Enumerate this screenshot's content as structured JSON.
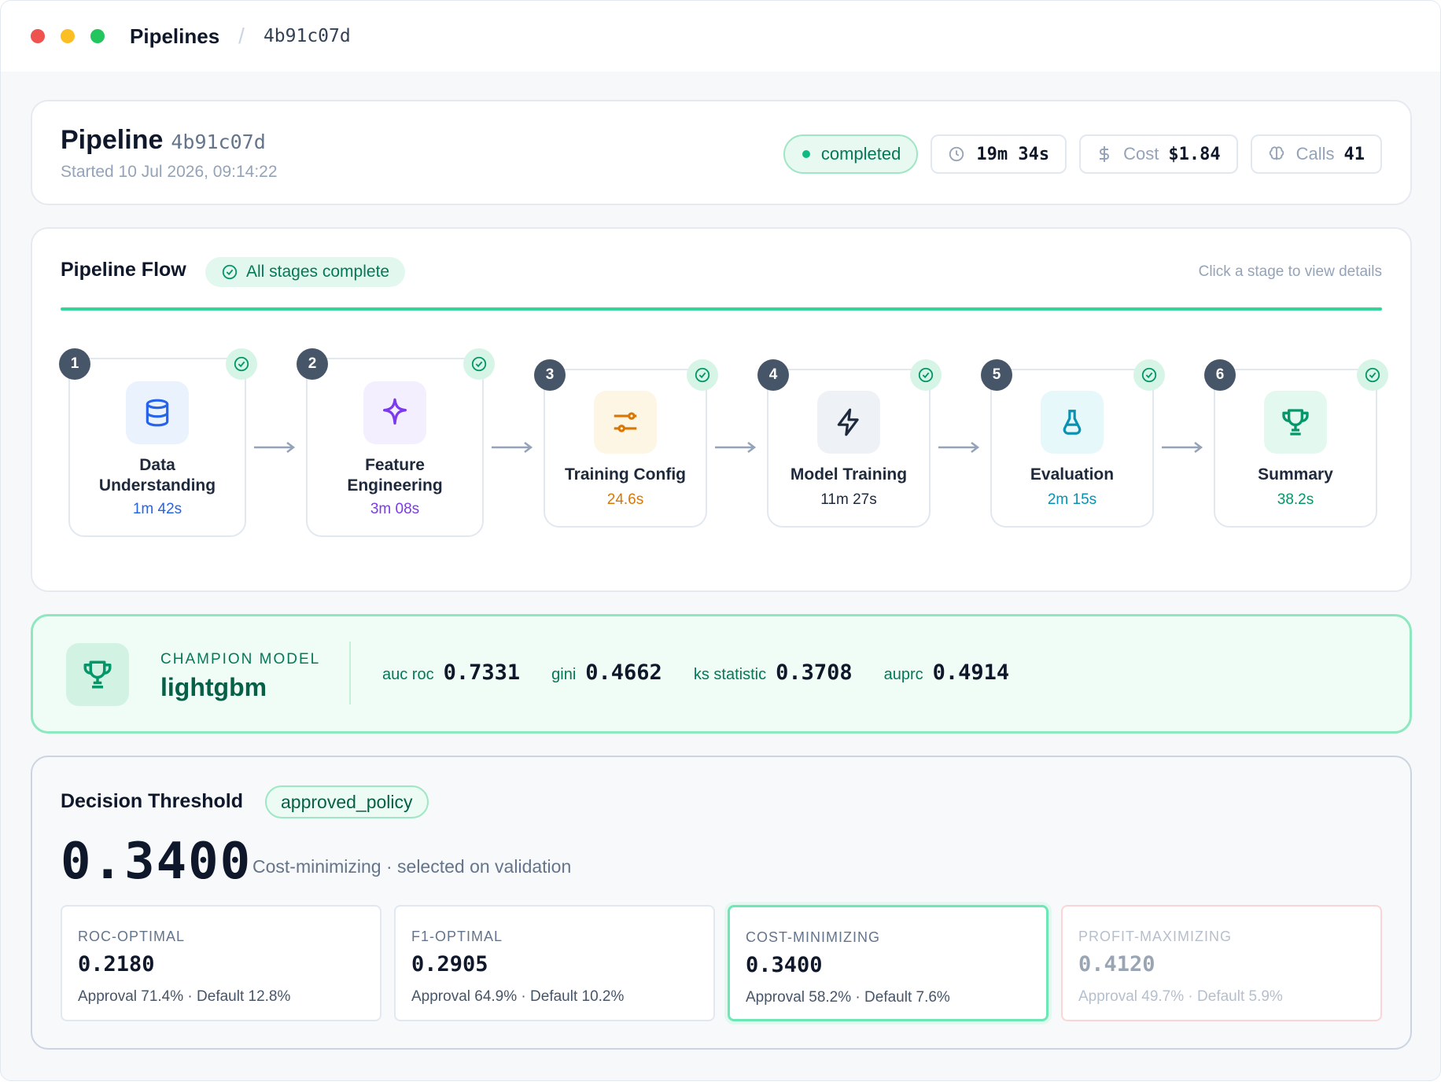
{
  "titlebar": {
    "dots": [
      "#ef5350",
      "#fbbf24",
      "#22c55e"
    ],
    "crumb_main": "Pipelines",
    "crumb_sep": "/",
    "crumb_id": "4b91c07d"
  },
  "header": {
    "title": "Pipeline",
    "id": "4b91c07d",
    "started": "Started 10 Jul 2026, 09:14:22",
    "status": "completed",
    "duration": "19m 34s",
    "cost_label": "Cost",
    "cost_value": "$1.84",
    "calls_label": "Calls",
    "calls_value": "41"
  },
  "flow": {
    "title": "Pipeline Flow",
    "badge": "All stages complete",
    "hint": "Click a stage to view details",
    "stages": [
      {
        "num": "1",
        "line1": "Data",
        "line2": "Understanding",
        "duration": "1m 42s",
        "icon": "database-icon",
        "color": "#2563eb",
        "bg": "#eaf2fe"
      },
      {
        "num": "2",
        "line1": "Feature",
        "line2": "Engineering",
        "duration": "3m 08s",
        "icon": "sparkle-icon",
        "color": "#7c3aed",
        "bg": "#f3effe"
      },
      {
        "num": "3",
        "line1": "Training Config",
        "line2": "",
        "duration": "24.6s",
        "icon": "sliders-icon",
        "color": "#d97706",
        "bg": "#fef6e4"
      },
      {
        "num": "4",
        "line1": "Model Training",
        "line2": "",
        "duration": "11m 27s",
        "icon": "lightning-icon",
        "color": "#1e293b",
        "bg": "#eef2f7"
      },
      {
        "num": "5",
        "line1": "Evaluation",
        "line2": "",
        "duration": "2m 15s",
        "icon": "flask-icon",
        "color": "#0891b2",
        "bg": "#e7f8fb"
      },
      {
        "num": "6",
        "line1": "Summary",
        "line2": "",
        "duration": "38.2s",
        "icon": "trophy-icon",
        "color": "#059669",
        "bg": "#e3f8ee"
      }
    ]
  },
  "champion": {
    "kicker": "CHAMPION MODEL",
    "model": "lightgbm",
    "metrics": [
      {
        "key": "auc roc",
        "value": "0.7331"
      },
      {
        "key": "gini",
        "value": "0.4662"
      },
      {
        "key": "ks statistic",
        "value": "0.3708"
      },
      {
        "key": "auprc",
        "value": "0.4914"
      }
    ]
  },
  "threshold": {
    "title": "Decision Threshold",
    "badge": "approved_policy",
    "value": "0.3400",
    "desc": "Cost-minimizing · selected on validation",
    "options": [
      {
        "label": "ROC-OPTIMAL",
        "value": "0.2180",
        "sub": "Approval 71.4% · Default 12.8%"
      },
      {
        "label": "F1-OPTIMAL",
        "value": "0.2905",
        "sub": "Approval 64.9% · Default 10.2%"
      },
      {
        "label": "COST-MINIMIZING",
        "value": "0.3400",
        "sub": "Approval 58.2% · Default 7.6%"
      },
      {
        "label": "PROFIT-MAXIMIZING",
        "value": "0.4120",
        "sub": "Approval 49.7% · Default 5.9%"
      }
    ]
  }
}
